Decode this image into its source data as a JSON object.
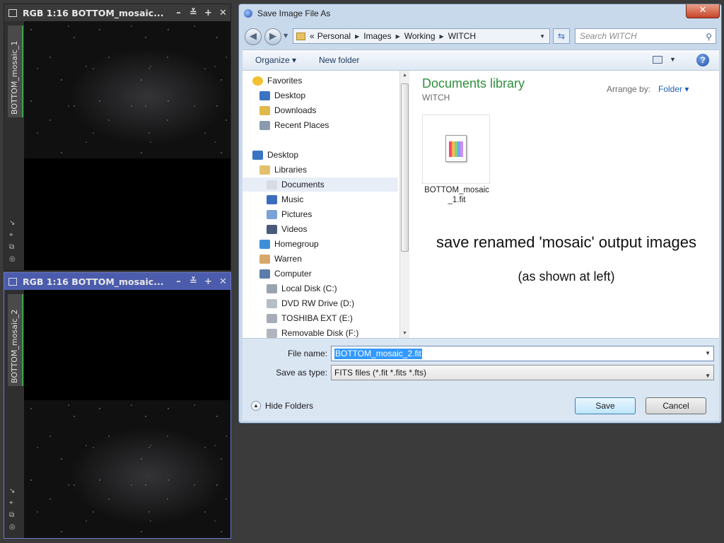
{
  "windows": [
    {
      "title": "RGB 1:16 BOTTOM_mosaic_1",
      "title_shown": "RGB 1:16 BOTTOM_mosaic...",
      "tab": "BOTTOM_mosaic_1",
      "buttons": [
        "–",
        "≚",
        "+",
        "✕"
      ],
      "active": false
    },
    {
      "title": "RGB 1:16 BOTTOM_mosaic_2",
      "title_shown": "RGB 1:16 BOTTOM_mosaic...",
      "tab": "BOTTOM_mosaic_2",
      "buttons": [
        "–",
        "≚",
        "+",
        "✕"
      ],
      "active": true
    }
  ],
  "side_icons": [
    "↘",
    "⌖",
    "⧉",
    "◎"
  ],
  "dialog": {
    "title": "Save Image File As",
    "close": "✕",
    "address": {
      "prefix": "«",
      "segments": [
        "Personal",
        "Images",
        "Working",
        "WITCH"
      ]
    },
    "search_placeholder": "Search WITCH",
    "toolbar": {
      "organize": "Organize ▾",
      "new_folder": "New folder",
      "help": "?"
    },
    "nav": [
      {
        "label": "Favorites",
        "icon": "star-icon",
        "level": 0
      },
      {
        "label": "Desktop",
        "icon": "desktop-icon",
        "level": 1
      },
      {
        "label": "Downloads",
        "icon": "downloads-icon",
        "level": 1
      },
      {
        "label": "Recent Places",
        "icon": "recent-places-icon",
        "level": 1
      },
      {
        "label": "Desktop",
        "icon": "desktop-icon",
        "level": 0
      },
      {
        "label": "Libraries",
        "icon": "libraries-icon",
        "level": 1
      },
      {
        "label": "Documents",
        "icon": "documents-icon",
        "level": 2,
        "selected": true
      },
      {
        "label": "Music",
        "icon": "music-icon",
        "level": 2
      },
      {
        "label": "Pictures",
        "icon": "pictures-icon",
        "level": 2
      },
      {
        "label": "Videos",
        "icon": "videos-icon",
        "level": 2
      },
      {
        "label": "Homegroup",
        "icon": "homegroup-icon",
        "level": 1
      },
      {
        "label": "Warren",
        "icon": "user-icon",
        "level": 1
      },
      {
        "label": "Computer",
        "icon": "computer-icon",
        "level": 1
      },
      {
        "label": "Local Disk (C:)",
        "icon": "disk-icon",
        "level": 2
      },
      {
        "label": "DVD RW Drive (D:)",
        "icon": "dvd-icon",
        "level": 2
      },
      {
        "label": "TOSHIBA EXT (E:)",
        "icon": "drive-icon",
        "level": 2
      },
      {
        "label": "Removable Disk (F:)",
        "icon": "removable-icon",
        "level": 2
      }
    ],
    "library": {
      "title": "Documents library",
      "subtitle": "WITCH",
      "arrange_by_label": "Arrange by:",
      "arrange_by_value": "Folder ▾"
    },
    "files": [
      {
        "name": "BOTTOM_mosaic_1.fit",
        "line1": "BOTTOM_mosaic",
        "line2": "_1.fit"
      }
    ],
    "annotation": {
      "line1": "save renamed 'mosaic' output images",
      "line2": "(as shown at left)"
    },
    "file_name_label": "File name:",
    "file_name_value": "BOTTOM_mosaic_2.fit",
    "save_type_label": "Save as type:",
    "save_type_value": "FITS files (*.fit *.fits *.fts)",
    "hide_folders": "Hide Folders",
    "save_button": "Save",
    "cancel_button": "Cancel"
  }
}
